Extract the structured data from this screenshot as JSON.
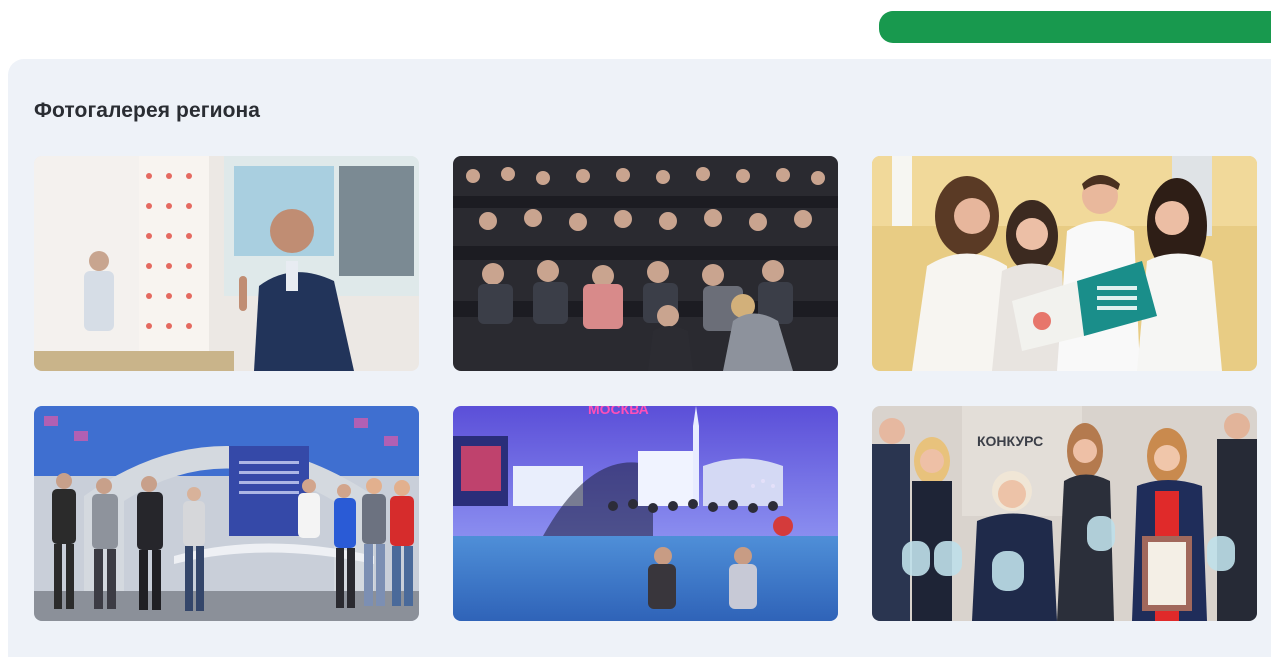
{
  "header": {
    "green_button_color": "#18994e"
  },
  "gallery": {
    "title": "Фотогалерея региона",
    "photos": [
      {
        "name": "photo-lecture-speaker",
        "text": ""
      },
      {
        "name": "photo-auditorium-audience",
        "text": ""
      },
      {
        "name": "photo-students-brochure",
        "text": ""
      },
      {
        "name": "photo-exhibition-pavilion",
        "text": ""
      },
      {
        "name": "photo-moscow-stage",
        "text": "МОСКВА"
      },
      {
        "name": "photo-award-winners",
        "text": "КОНКУРС"
      }
    ]
  }
}
